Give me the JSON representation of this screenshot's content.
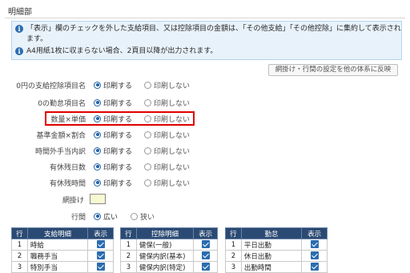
{
  "section": {
    "title": "明細部"
  },
  "info": {
    "line1a": "「表示」欄のチェックを外した支給項目、又は控除項目の金額は、「その他支給」「その他控除」に集約して表示され",
    "line1b": "ます。",
    "line2": "A4用紙1枚に収まらない場合、2頁目以降が出力されます。",
    "icon": "info-icon"
  },
  "reflect_button": {
    "label": "網掛け・行間の設定を他の体系に反映"
  },
  "options": [
    {
      "label": "0円の支給控除項目名",
      "on": "印刷する",
      "off": "印刷しない",
      "selected": "on"
    },
    {
      "label": "0の勤怠項目名",
      "on": "印刷する",
      "off": "印刷しない",
      "selected": "on"
    },
    {
      "label": "数量×単価",
      "on": "印刷する",
      "off": "印刷しない",
      "selected": "on"
    },
    {
      "label": "基準金額×割合",
      "on": "印刷する",
      "off": "印刷しない",
      "selected": "on"
    },
    {
      "label": "時間外手当内訳",
      "on": "印刷する",
      "off": "印刷しない",
      "selected": "on"
    },
    {
      "label": "有休残日数",
      "on": "印刷する",
      "off": "印刷しない",
      "selected": "on"
    },
    {
      "label": "有休残時間",
      "on": "印刷する",
      "off": "印刷しない",
      "selected": "on"
    }
  ],
  "shading": {
    "label": "網掛け",
    "color": "#f6f9d2"
  },
  "line_spacing": {
    "label": "行間",
    "wide": "広い",
    "narrow": "狭い",
    "selected": "wide"
  },
  "tables": {
    "payment": {
      "headers": [
        "行",
        "支給明細",
        "表示"
      ],
      "rows": [
        {
          "no": "1",
          "name": "時給",
          "checked": true
        },
        {
          "no": "2",
          "name": "職務手当",
          "checked": true
        },
        {
          "no": "3",
          "name": "特別手当",
          "checked": true
        }
      ]
    },
    "deduction": {
      "headers": [
        "行",
        "控除明細",
        "表示"
      ],
      "rows": [
        {
          "no": "1",
          "name": "健保(一般)",
          "checked": true
        },
        {
          "no": "2",
          "name": "健保内訳(基本)",
          "checked": true
        },
        {
          "no": "3",
          "name": "健保内訳(特定)",
          "checked": true
        }
      ]
    },
    "attendance": {
      "headers": [
        "行",
        "勤怠",
        "表示"
      ],
      "rows": [
        {
          "no": "1",
          "name": "平日出勤",
          "checked": true
        },
        {
          "no": "2",
          "name": "休日出勤",
          "checked": true
        },
        {
          "no": "3",
          "name": "出勤時間",
          "checked": true
        }
      ]
    }
  },
  "colors": {
    "header_bg": "#2b4a73",
    "accent": "#1f5fa8",
    "highlight": "#e00000",
    "info_bg": "#e8f2fb"
  }
}
